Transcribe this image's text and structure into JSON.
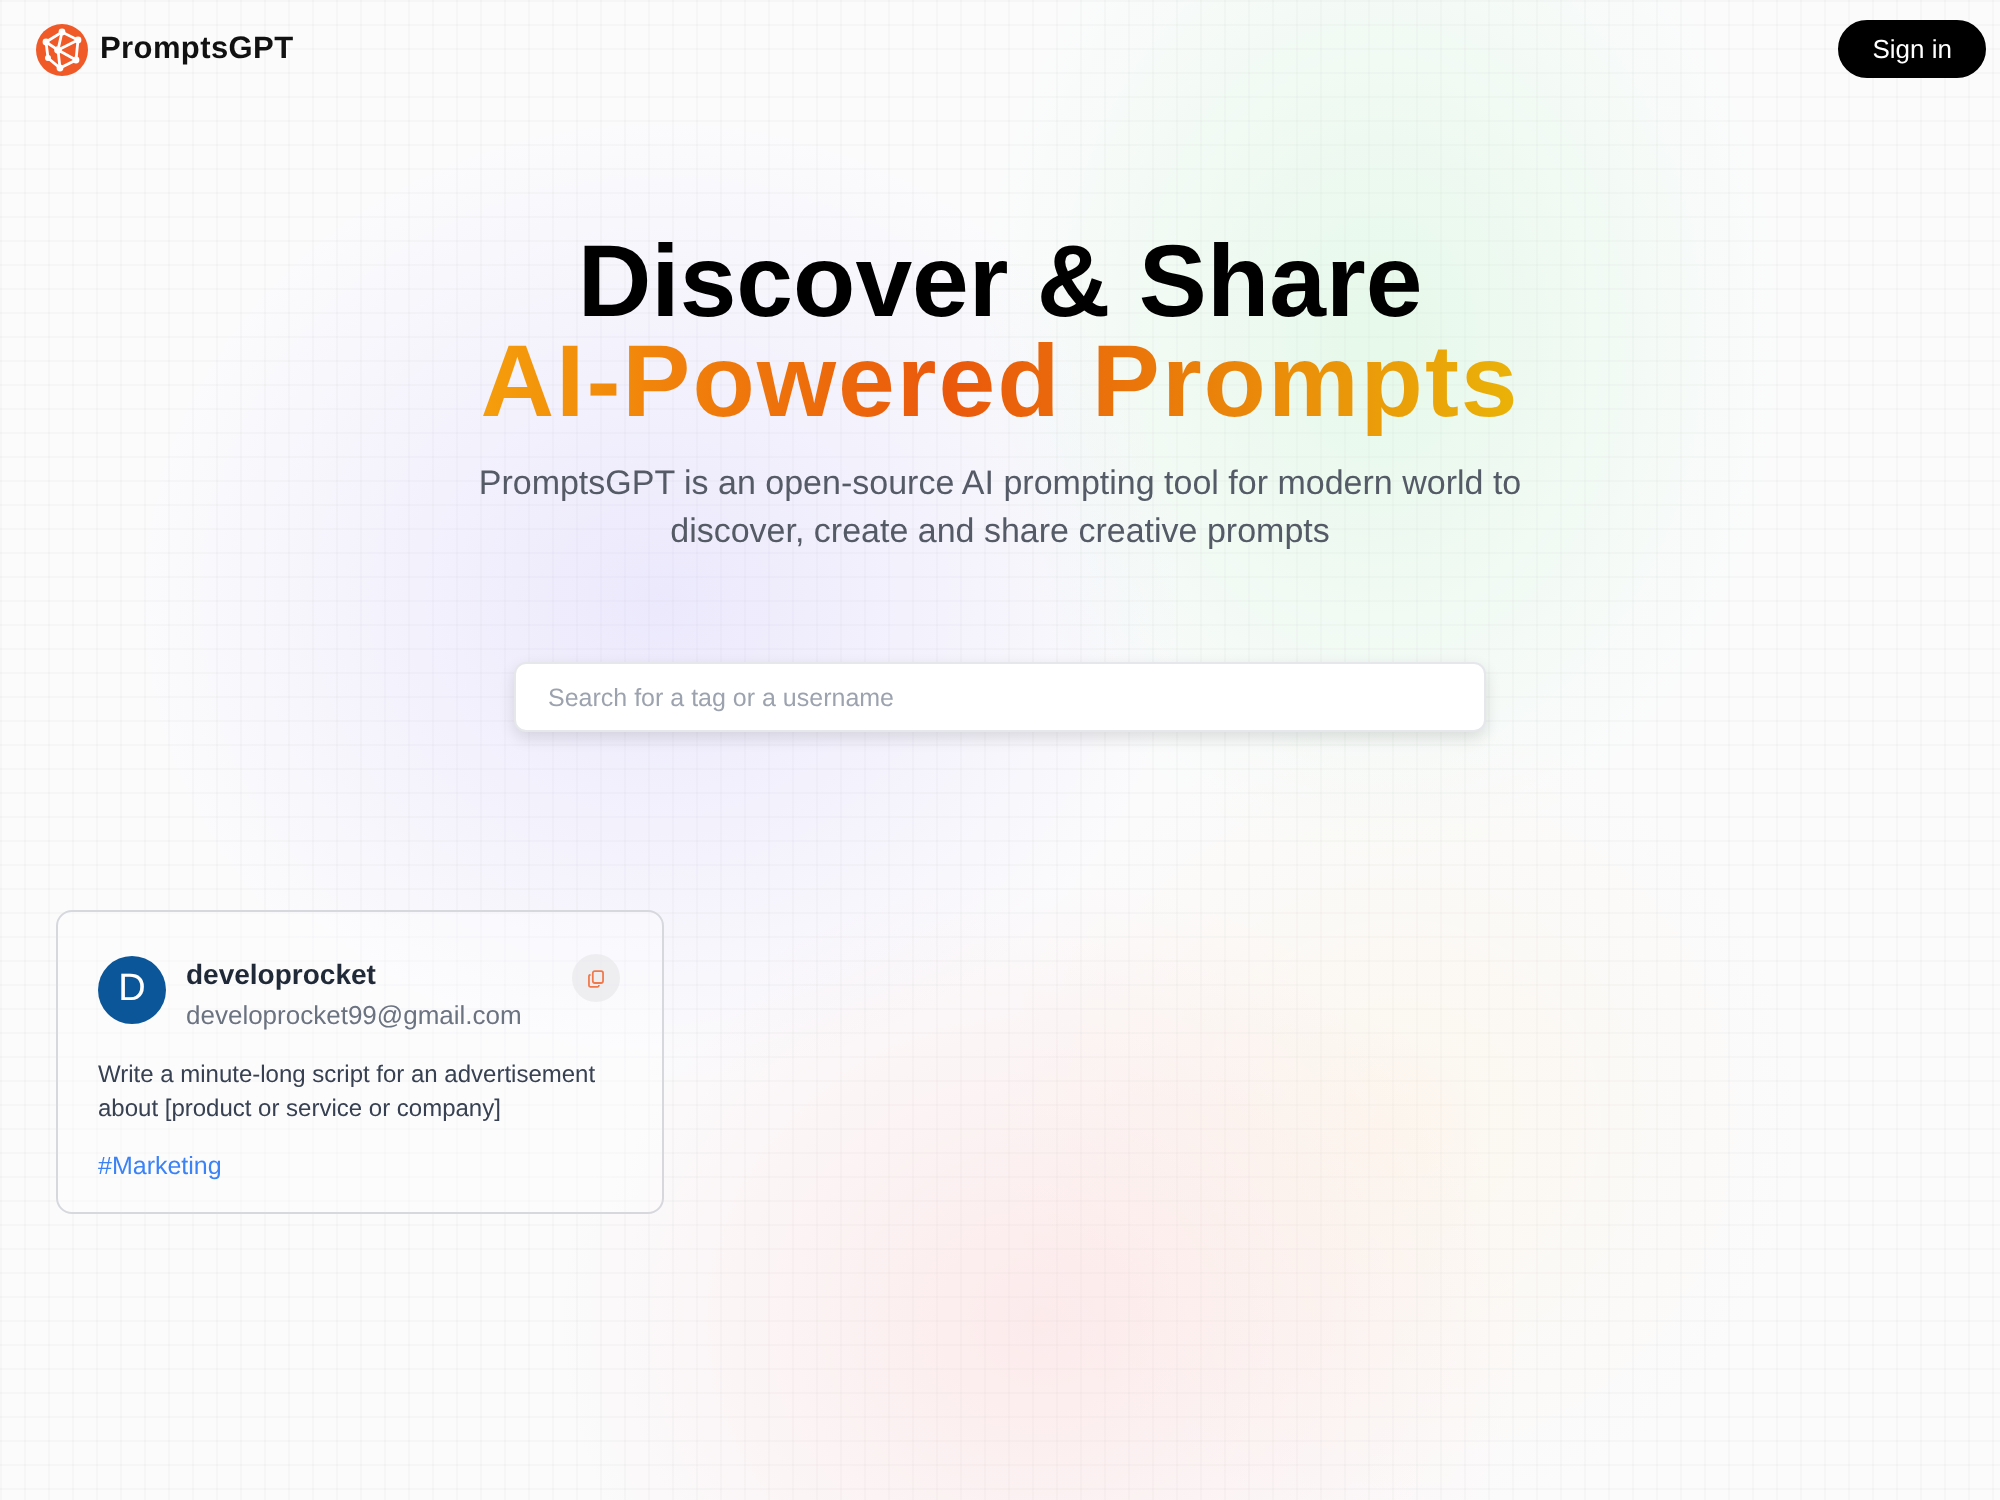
{
  "header": {
    "logo_text": "PromptsGPT",
    "sign_in_button": "Sign in"
  },
  "hero": {
    "title": "Discover & Share",
    "highlight": "AI-Powered Prompts",
    "description": "PromptsGPT is an open-source AI prompting tool for modern world to discover, create and share creative prompts"
  },
  "search": {
    "placeholder": "Search for a tag or a username"
  },
  "prompts": [
    {
      "avatar": "D",
      "username": "developrocket",
      "email": "developrocket99@gmail.com",
      "prompt": "Write a minute-long script for an advertisement about [product or service or company]",
      "tag": "#Marketing"
    }
  ]
}
